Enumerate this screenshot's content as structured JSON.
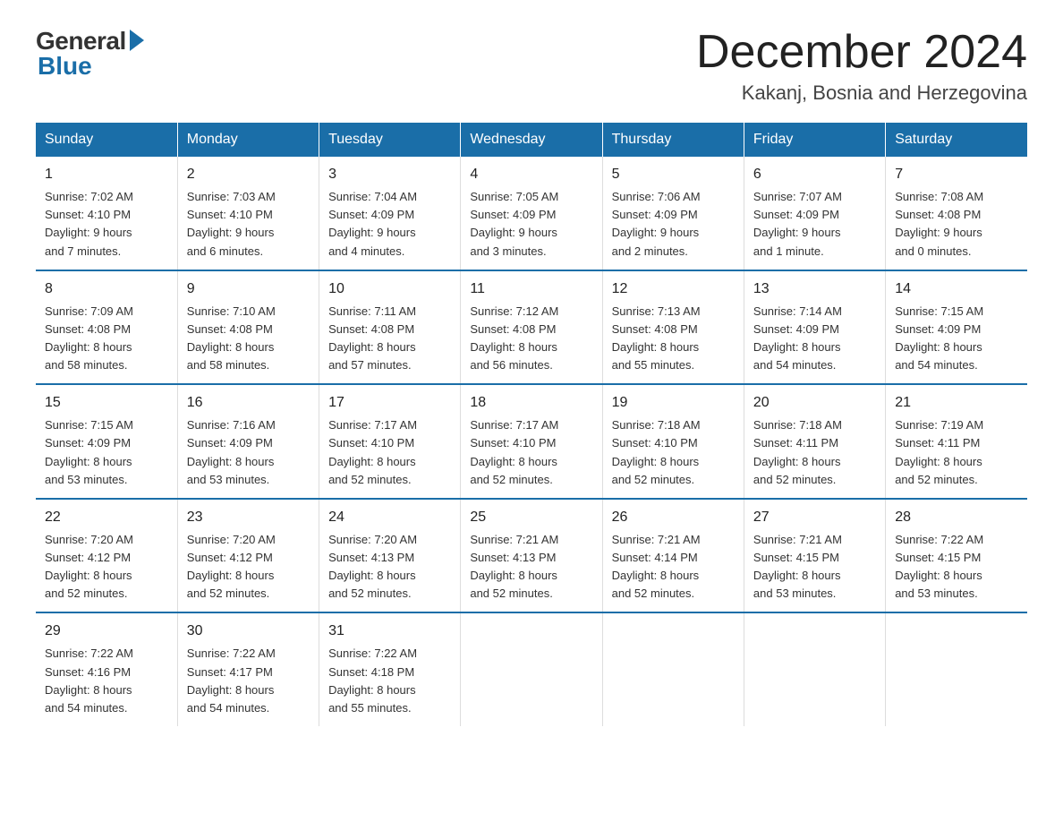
{
  "logo": {
    "general": "General",
    "blue": "Blue"
  },
  "title": "December 2024",
  "location": "Kakanj, Bosnia and Herzegovina",
  "days_of_week": [
    "Sunday",
    "Monday",
    "Tuesday",
    "Wednesday",
    "Thursday",
    "Friday",
    "Saturday"
  ],
  "weeks": [
    [
      {
        "day": "1",
        "info": "Sunrise: 7:02 AM\nSunset: 4:10 PM\nDaylight: 9 hours\nand 7 minutes."
      },
      {
        "day": "2",
        "info": "Sunrise: 7:03 AM\nSunset: 4:10 PM\nDaylight: 9 hours\nand 6 minutes."
      },
      {
        "day": "3",
        "info": "Sunrise: 7:04 AM\nSunset: 4:09 PM\nDaylight: 9 hours\nand 4 minutes."
      },
      {
        "day": "4",
        "info": "Sunrise: 7:05 AM\nSunset: 4:09 PM\nDaylight: 9 hours\nand 3 minutes."
      },
      {
        "day": "5",
        "info": "Sunrise: 7:06 AM\nSunset: 4:09 PM\nDaylight: 9 hours\nand 2 minutes."
      },
      {
        "day": "6",
        "info": "Sunrise: 7:07 AM\nSunset: 4:09 PM\nDaylight: 9 hours\nand 1 minute."
      },
      {
        "day": "7",
        "info": "Sunrise: 7:08 AM\nSunset: 4:08 PM\nDaylight: 9 hours\nand 0 minutes."
      }
    ],
    [
      {
        "day": "8",
        "info": "Sunrise: 7:09 AM\nSunset: 4:08 PM\nDaylight: 8 hours\nand 58 minutes."
      },
      {
        "day": "9",
        "info": "Sunrise: 7:10 AM\nSunset: 4:08 PM\nDaylight: 8 hours\nand 58 minutes."
      },
      {
        "day": "10",
        "info": "Sunrise: 7:11 AM\nSunset: 4:08 PM\nDaylight: 8 hours\nand 57 minutes."
      },
      {
        "day": "11",
        "info": "Sunrise: 7:12 AM\nSunset: 4:08 PM\nDaylight: 8 hours\nand 56 minutes."
      },
      {
        "day": "12",
        "info": "Sunrise: 7:13 AM\nSunset: 4:08 PM\nDaylight: 8 hours\nand 55 minutes."
      },
      {
        "day": "13",
        "info": "Sunrise: 7:14 AM\nSunset: 4:09 PM\nDaylight: 8 hours\nand 54 minutes."
      },
      {
        "day": "14",
        "info": "Sunrise: 7:15 AM\nSunset: 4:09 PM\nDaylight: 8 hours\nand 54 minutes."
      }
    ],
    [
      {
        "day": "15",
        "info": "Sunrise: 7:15 AM\nSunset: 4:09 PM\nDaylight: 8 hours\nand 53 minutes."
      },
      {
        "day": "16",
        "info": "Sunrise: 7:16 AM\nSunset: 4:09 PM\nDaylight: 8 hours\nand 53 minutes."
      },
      {
        "day": "17",
        "info": "Sunrise: 7:17 AM\nSunset: 4:10 PM\nDaylight: 8 hours\nand 52 minutes."
      },
      {
        "day": "18",
        "info": "Sunrise: 7:17 AM\nSunset: 4:10 PM\nDaylight: 8 hours\nand 52 minutes."
      },
      {
        "day": "19",
        "info": "Sunrise: 7:18 AM\nSunset: 4:10 PM\nDaylight: 8 hours\nand 52 minutes."
      },
      {
        "day": "20",
        "info": "Sunrise: 7:18 AM\nSunset: 4:11 PM\nDaylight: 8 hours\nand 52 minutes."
      },
      {
        "day": "21",
        "info": "Sunrise: 7:19 AM\nSunset: 4:11 PM\nDaylight: 8 hours\nand 52 minutes."
      }
    ],
    [
      {
        "day": "22",
        "info": "Sunrise: 7:20 AM\nSunset: 4:12 PM\nDaylight: 8 hours\nand 52 minutes."
      },
      {
        "day": "23",
        "info": "Sunrise: 7:20 AM\nSunset: 4:12 PM\nDaylight: 8 hours\nand 52 minutes."
      },
      {
        "day": "24",
        "info": "Sunrise: 7:20 AM\nSunset: 4:13 PM\nDaylight: 8 hours\nand 52 minutes."
      },
      {
        "day": "25",
        "info": "Sunrise: 7:21 AM\nSunset: 4:13 PM\nDaylight: 8 hours\nand 52 minutes."
      },
      {
        "day": "26",
        "info": "Sunrise: 7:21 AM\nSunset: 4:14 PM\nDaylight: 8 hours\nand 52 minutes."
      },
      {
        "day": "27",
        "info": "Sunrise: 7:21 AM\nSunset: 4:15 PM\nDaylight: 8 hours\nand 53 minutes."
      },
      {
        "day": "28",
        "info": "Sunrise: 7:22 AM\nSunset: 4:15 PM\nDaylight: 8 hours\nand 53 minutes."
      }
    ],
    [
      {
        "day": "29",
        "info": "Sunrise: 7:22 AM\nSunset: 4:16 PM\nDaylight: 8 hours\nand 54 minutes."
      },
      {
        "day": "30",
        "info": "Sunrise: 7:22 AM\nSunset: 4:17 PM\nDaylight: 8 hours\nand 54 minutes."
      },
      {
        "day": "31",
        "info": "Sunrise: 7:22 AM\nSunset: 4:18 PM\nDaylight: 8 hours\nand 55 minutes."
      },
      {
        "day": "",
        "info": ""
      },
      {
        "day": "",
        "info": ""
      },
      {
        "day": "",
        "info": ""
      },
      {
        "day": "",
        "info": ""
      }
    ]
  ]
}
